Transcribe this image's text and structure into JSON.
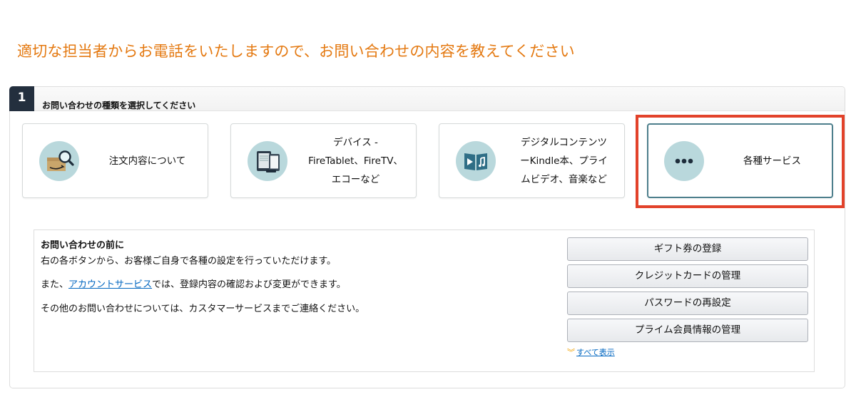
{
  "headline": "適切な担当者からお電話をいたしますので、お問い合わせの内容を教えてください",
  "step": {
    "number": "1",
    "title": "お問い合わせの種類を選択してください"
  },
  "categories": [
    {
      "icon": "order-search-icon",
      "lines": [
        "注文内容について"
      ]
    },
    {
      "icon": "devices-icon",
      "lines": [
        "デバイス -",
        "FireTablet、FireTV、",
        "エコーなど"
      ]
    },
    {
      "icon": "digital-content-icon",
      "lines": [
        "デジタルコンテンツ",
        "ーKindle本、プライ",
        "ムビデオ、音楽など"
      ]
    },
    {
      "icon": "more-dots-icon",
      "lines": [
        "各種サービス"
      ]
    }
  ],
  "selected_category": "各種サービス",
  "highlight_color": "#e2422a",
  "accent_color": "#e47911",
  "info": {
    "title": "お問い合わせの前に",
    "line1": "右の各ボタンから、お客様ご自身で各種の設定を行っていただけます。",
    "line2_prefix": "また、",
    "line2_link": "アカウントサービス",
    "line2_suffix": "では、登録内容の確認および変更ができます。",
    "line3": "その他のお問い合わせについては、カスタマーサービスまでご連絡ください。"
  },
  "quick_buttons": [
    "ギフト券の登録",
    "クレジットカードの管理",
    "パスワードの再設定",
    "プライム会員情報の管理"
  ],
  "see_all": "すべて表示"
}
